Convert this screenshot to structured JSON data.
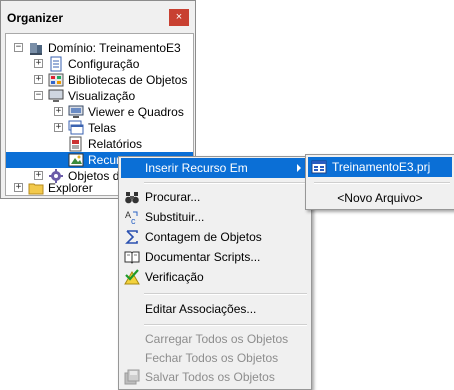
{
  "panel": {
    "title": "Organizer",
    "close_glyph": "×",
    "close_color": "#c84031"
  },
  "tree": {
    "items": [
      {
        "label": "Domínio: TreinamentoE3",
        "icon": "domain-icon",
        "expander": "−"
      },
      {
        "label": "Configuração",
        "icon": "config-icon",
        "expander": "+"
      },
      {
        "label": "Bibliotecas de Objetos",
        "icon": "library-icon",
        "expander": "+"
      },
      {
        "label": "Visualização",
        "icon": "monitor-icon",
        "expander": "−"
      },
      {
        "label": "Viewer e Quadros",
        "icon": "viewer-icon",
        "expander": "+"
      },
      {
        "label": "Telas",
        "icon": "screens-icon",
        "expander": "+"
      },
      {
        "label": "Relatórios",
        "icon": "report-icon",
        "expander": ""
      },
      {
        "label": "Recursos",
        "icon": "resources-icon",
        "expander": ""
      },
      {
        "label": "Objetos de",
        "icon": "server-objects-icon",
        "expander": "+"
      },
      {
        "label": "Explorer",
        "icon": "folder-icon",
        "expander": "+"
      }
    ]
  },
  "context_menu": {
    "items": [
      {
        "label": "Inserir Recurso Em",
        "icon": "",
        "has_submenu": true
      },
      {
        "label": "Procurar...",
        "icon": "binoculars-icon"
      },
      {
        "label": "Substituir...",
        "icon": "replace-icon"
      },
      {
        "label": "Contagem de Objetos",
        "icon": "sigma-icon"
      },
      {
        "label": "Documentar Scripts...",
        "icon": "book-icon"
      },
      {
        "label": "Verificação",
        "icon": "check-warning-icon"
      },
      {
        "label": "Editar Associações...",
        "icon": ""
      },
      {
        "label": "Carregar Todos os Objetos",
        "icon": ""
      },
      {
        "label": "Fechar Todos os Objetos",
        "icon": ""
      },
      {
        "label": "Salvar Todos os Objetos",
        "icon": "save-all-icon"
      }
    ]
  },
  "submenu": {
    "items": [
      {
        "label": "TreinamentoE3.prj",
        "icon": "project-icon"
      },
      {
        "label": "<Novo Arquivo>",
        "icon": ""
      }
    ]
  },
  "colors": {
    "selection": "#0b6fd6",
    "menu_bg": "#f0f0f0",
    "disabled_text": "#8d8d8d"
  }
}
